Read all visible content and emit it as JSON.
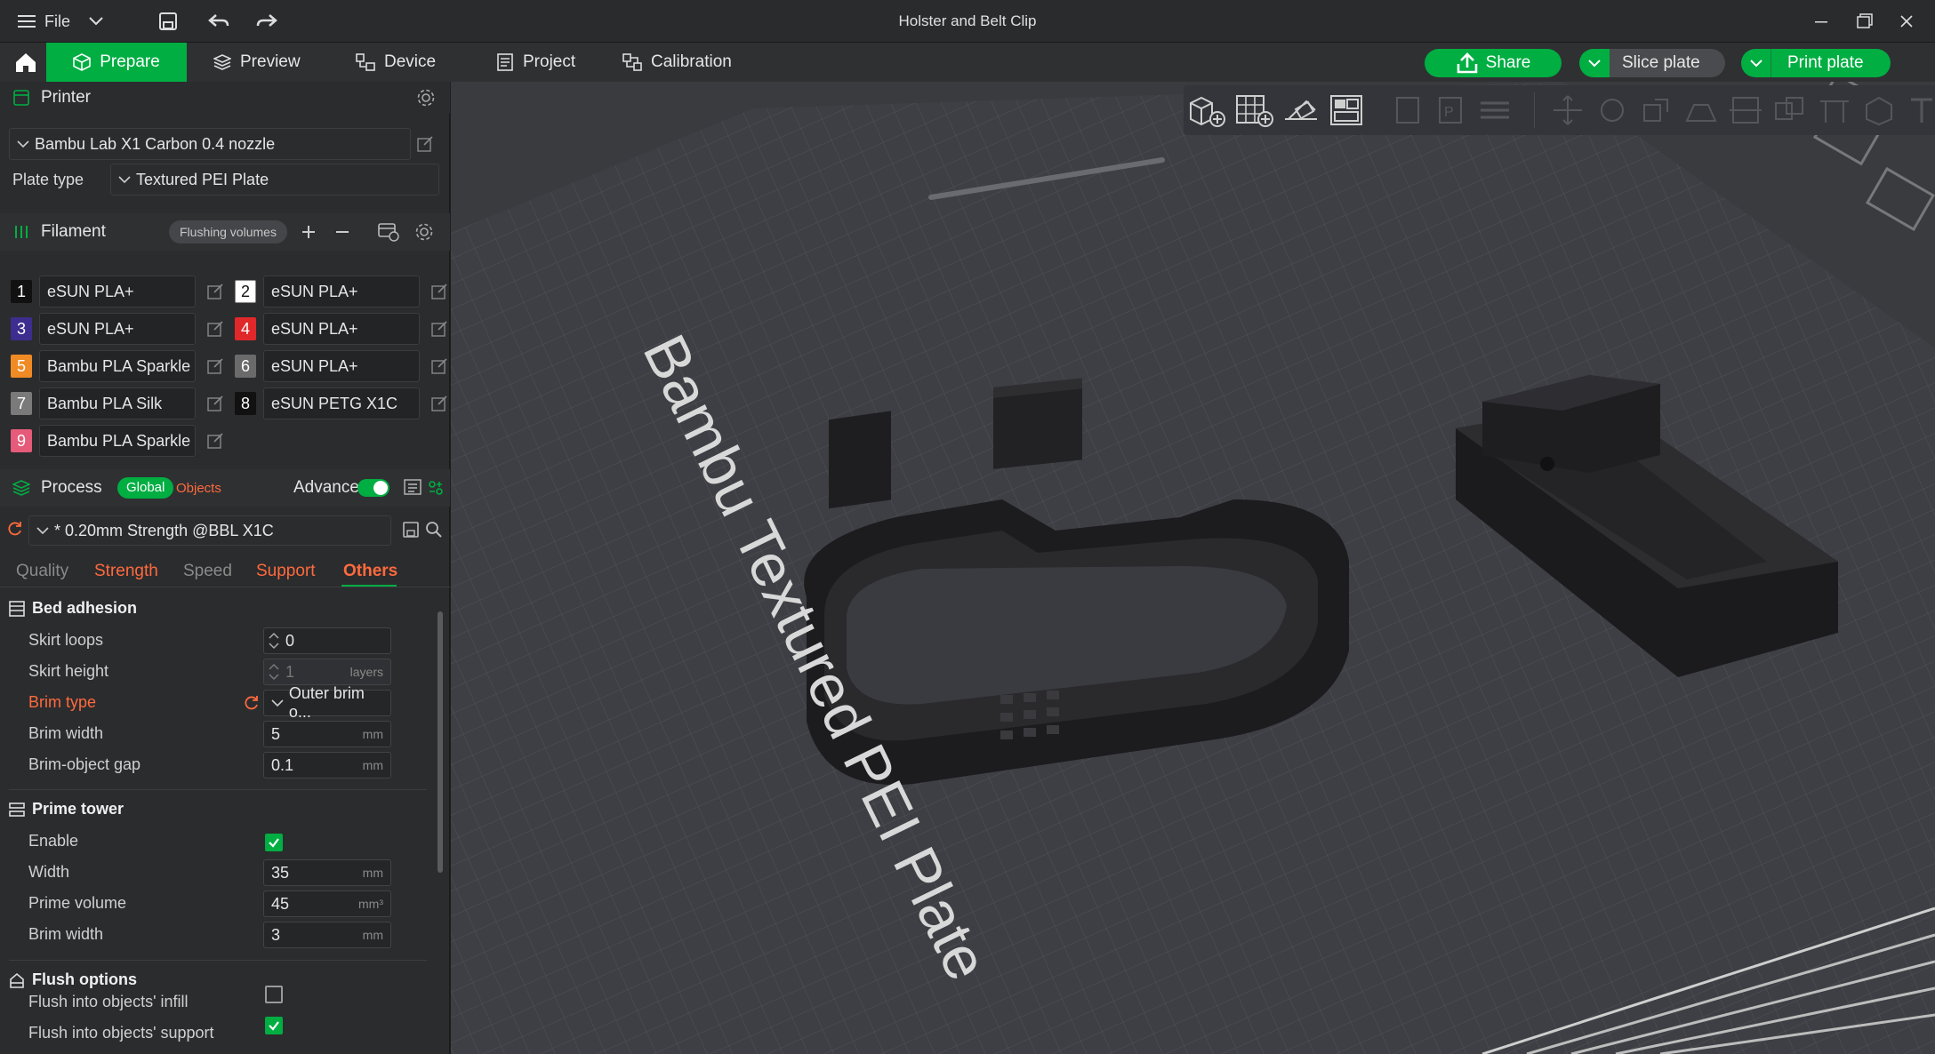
{
  "window": {
    "title": "Holster and Belt Clip",
    "menu_label": "File"
  },
  "tabs": [
    {
      "label": "Prepare",
      "active": true
    },
    {
      "label": "Preview"
    },
    {
      "label": "Device"
    },
    {
      "label": "Project"
    },
    {
      "label": "Calibration"
    }
  ],
  "actions": {
    "share": "Share",
    "slice": "Slice plate",
    "print": "Print plate"
  },
  "colors": {
    "accent": "#00ae42",
    "warning": "#ff6a3d"
  },
  "printer": {
    "section_title": "Printer",
    "model": "Bambu Lab X1 Carbon 0.4 nozzle",
    "plate_type_label": "Plate type",
    "plate_type": "Textured PEI Plate"
  },
  "filament": {
    "section_title": "Filament",
    "flushing_label": "Flushing volumes",
    "items": [
      {
        "num": "1",
        "name": "eSUN PLA+",
        "color": "#111111"
      },
      {
        "num": "2",
        "name": "eSUN PLA+",
        "color": "#ffffff",
        "text_color": "#111111"
      },
      {
        "num": "3",
        "name": "eSUN PLA+",
        "color": "#3d2d8e"
      },
      {
        "num": "4",
        "name": "eSUN PLA+",
        "color": "#e0282b"
      },
      {
        "num": "5",
        "name": "Bambu PLA Sparkle",
        "color": "#f08a24"
      },
      {
        "num": "6",
        "name": "eSUN PLA+",
        "color": "#6a6a6a"
      },
      {
        "num": "7",
        "name": "Bambu PLA Silk",
        "color": "#7a7a7a"
      },
      {
        "num": "8",
        "name": "eSUN PETG X1C",
        "color": "#111111"
      },
      {
        "num": "9",
        "name": "Bambu PLA Sparkle",
        "color": "#e65a7a"
      }
    ]
  },
  "process": {
    "section_title": "Process",
    "global_label": "Global",
    "objects_label": "Objects",
    "advance_label": "Advance",
    "preset": "* 0.20mm Strength @BBL X1C",
    "subtabs": [
      "Quality",
      "Strength",
      "Speed",
      "Support",
      "Others"
    ],
    "bed_adhesion": {
      "title": "Bed adhesion",
      "skirt_loops_label": "Skirt loops",
      "skirt_loops": "0",
      "skirt_height_label": "Skirt height",
      "skirt_height": "1",
      "skirt_height_unit": "layers",
      "brim_type_label": "Brim type",
      "brim_type": "Outer brim o...",
      "brim_width_label": "Brim width",
      "brim_width": "5",
      "mm": "mm",
      "brim_gap_label": "Brim-object gap",
      "brim_gap": "0.1"
    },
    "prime_tower": {
      "title": "Prime tower",
      "enable_label": "Enable",
      "width_label": "Width",
      "width": "35",
      "volume_label": "Prime volume",
      "volume": "45",
      "volume_unit": "mm³",
      "brim_label": "Brim width",
      "brim": "3"
    },
    "flush": {
      "title": "Flush options",
      "infill_label": "Flush into objects' infill",
      "support_label": "Flush into objects' support"
    }
  },
  "plate_label": "Bambu Textured PEI Plate"
}
